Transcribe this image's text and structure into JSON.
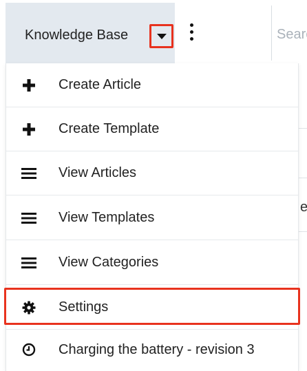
{
  "header": {
    "module_label": "Knowledge Base",
    "search_placeholder": "Search"
  },
  "menu": {
    "items": [
      {
        "label": "Create Article",
        "icon": "plus-icon"
      },
      {
        "label": "Create Template",
        "icon": "plus-icon"
      },
      {
        "label": "View Articles",
        "icon": "list-icon"
      },
      {
        "label": "View Templates",
        "icon": "list-icon"
      },
      {
        "label": "View Categories",
        "icon": "list-icon"
      },
      {
        "label": "Settings",
        "icon": "gear-icon"
      },
      {
        "label": "Charging the battery - revision 3",
        "icon": "clock-icon"
      }
    ]
  },
  "background": {
    "partial_text": "e"
  },
  "colors": {
    "highlight": "#e8321e",
    "tab_bg": "#e3e9ef"
  }
}
